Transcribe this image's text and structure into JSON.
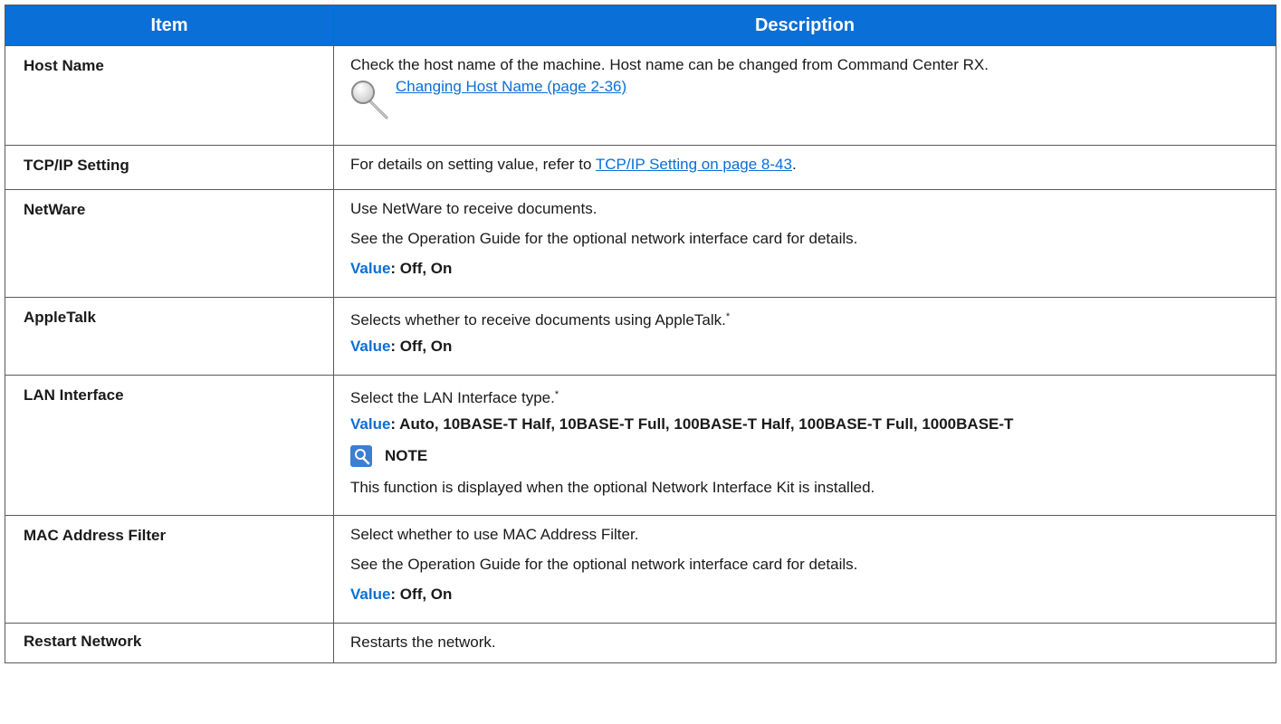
{
  "headers": {
    "item": "Item",
    "description": "Description"
  },
  "rows": {
    "host_name": {
      "item": "Host Name",
      "text": "Check the host name of the machine. Host name can be changed from Command Center RX.",
      "ref_link": "Changing Host Name (page 2-36)"
    },
    "tcpip": {
      "item": "TCP/IP Setting",
      "text_before": "For details on setting value, refer to ",
      "link": "TCP/IP Setting on page 8-43",
      "text_after": "."
    },
    "netware": {
      "item": "NetWare",
      "line1": "Use NetWare to receive documents.",
      "line2": "See the Operation Guide for the optional network interface card for details.",
      "value_key": "Value",
      "value_text": ": Off, On"
    },
    "appletalk": {
      "item": "AppleTalk",
      "line1": "Selects whether to receive documents using AppleTalk.",
      "footnote_mark": "*",
      "value_key": "Value",
      "value_text": ": Off, On"
    },
    "lan_interface": {
      "item": "LAN Interface",
      "line1": "Select the LAN Interface type.",
      "footnote_mark": "*",
      "value_key": "Value",
      "value_text": ": Auto, 10BASE-T Half, 10BASE-T Full, 100BASE-T Half, 100BASE-T Full, 1000BASE-T",
      "note_label": "NOTE",
      "note_text": "This function is displayed when the optional Network Interface Kit is installed."
    },
    "mac_filter": {
      "item": "MAC Address Filter",
      "line1": "Select whether to use MAC Address Filter.",
      "line2": "See the Operation Guide for the optional network interface card for details.",
      "value_key": "Value",
      "value_text": ": Off, On"
    },
    "restart": {
      "item": "Restart Network",
      "line1": "Restarts the network."
    }
  },
  "icons": {
    "reference": "magnifier-icon",
    "note": "note-icon"
  },
  "colors": {
    "header_bg": "#0a6fd6",
    "accent": "#0a6fd6",
    "border": "#5a5a5a"
  }
}
